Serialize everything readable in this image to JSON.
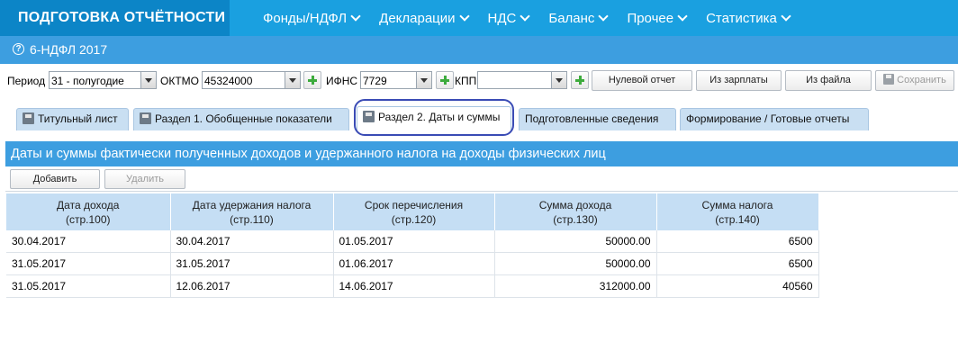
{
  "topbar": {
    "brand": "ПОДГОТОВКА ОТЧЁТНОСТИ",
    "menu": [
      "Фонды/НДФЛ",
      "Декларации",
      "НДС",
      "Баланс",
      "Прочее",
      "Статистика"
    ]
  },
  "subtitle": {
    "icon": "?",
    "text": "6-НДФЛ 2017"
  },
  "filters": {
    "period_label": "Период",
    "period_value": "31 - полугодие",
    "oktmo_label": "ОКТМО",
    "oktmo_value": "45324000",
    "ifns_label": "ИФНС",
    "ifns_value": "7729",
    "kpp_label": "КПП",
    "kpp_value": "",
    "buttons": {
      "zero": "Нулевой отчет",
      "from_salary": "Из зарплаты",
      "from_file": "Из файла",
      "save": "Сохранить"
    }
  },
  "tabs": [
    "Титульный лист",
    "Раздел 1. Обобщенные показатели",
    "Раздел 2. Даты и суммы",
    "Подготовленные сведения",
    "Формирование / Готовые отчеты"
  ],
  "section": {
    "title": "Даты и суммы фактически полученных доходов и удержанного налога на доходы физических лиц",
    "add_label": "Добавить",
    "delete_label": "Удалить"
  },
  "table": {
    "headers": [
      [
        "Дата дохода",
        "(стр.100)"
      ],
      [
        "Дата удержания налога",
        "(стр.110)"
      ],
      [
        "Срок перечисления",
        "(стр.120)"
      ],
      [
        "Сумма дохода",
        "(стр.130)"
      ],
      [
        "Сумма налога",
        "(стр.140)"
      ]
    ],
    "rows": [
      [
        "30.04.2017",
        "30.04.2017",
        "01.05.2017",
        "50000.00",
        "6500"
      ],
      [
        "31.05.2017",
        "31.05.2017",
        "01.06.2017",
        "50000.00",
        "6500"
      ],
      [
        "31.05.2017",
        "12.06.2017",
        "14.06.2017",
        "312000.00",
        "40560"
      ]
    ]
  },
  "colors": {
    "topbar": "#1aa0e0",
    "brand": "#0c85c7",
    "section": "#3d9ee0",
    "tab": "#c9dff2",
    "table_header": "#c5def4",
    "highlight": "#3a4bb5"
  }
}
